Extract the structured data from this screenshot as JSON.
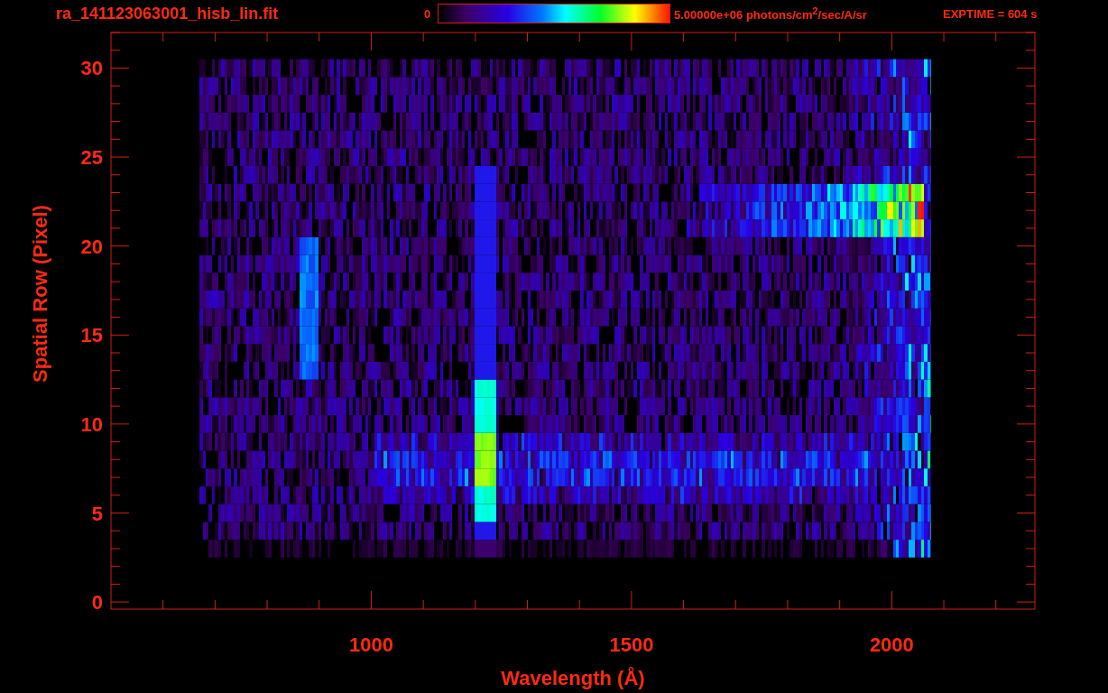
{
  "header": {
    "title": "ra_141123063001_hisb_lin.fit",
    "colorbar": {
      "min_label": "0",
      "max_label": "5.00000e+06 photons/cm$^{2}$/sec/A/sr"
    },
    "exposure": "EXPTIME = 604 s"
  },
  "plot": {
    "ylabel": "Spatial Row (Pixel)",
    "yticks": [
      "30",
      "25",
      "20",
      "15",
      "10",
      "5",
      "0"
    ],
    "xticks": [
      "1000",
      "1500",
      "2000"
    ],
    "xlabel": "Wavelength (Å)"
  }
}
